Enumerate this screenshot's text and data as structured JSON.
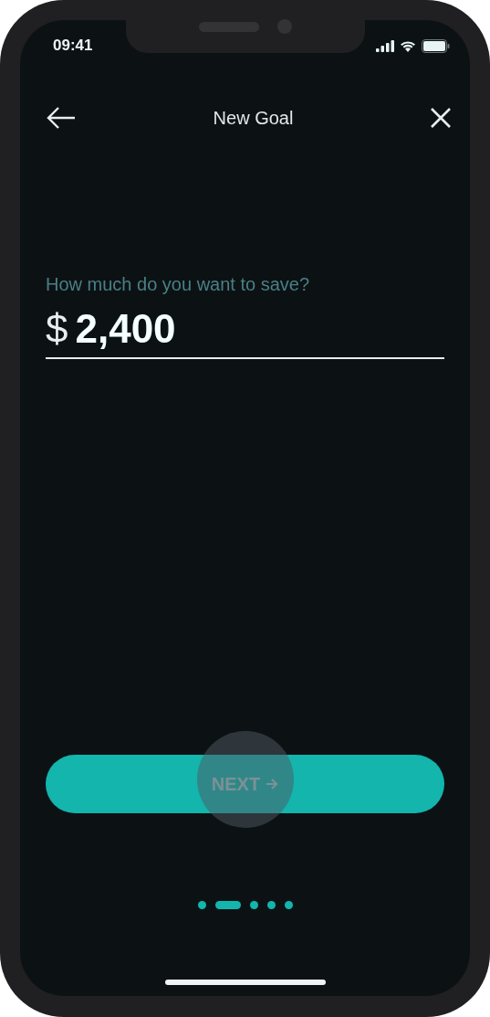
{
  "status_bar": {
    "time": "09:41"
  },
  "header": {
    "title": "New Goal"
  },
  "amount_field": {
    "label": "How much do you want to save?",
    "currency": "$",
    "value": "2,400"
  },
  "next_button": {
    "label": "NEXT",
    "pressed": true
  },
  "page_dots": [
    {
      "selected": false
    },
    {
      "selected": true
    },
    {
      "selected": false
    },
    {
      "selected": false
    },
    {
      "selected": false
    }
  ]
}
